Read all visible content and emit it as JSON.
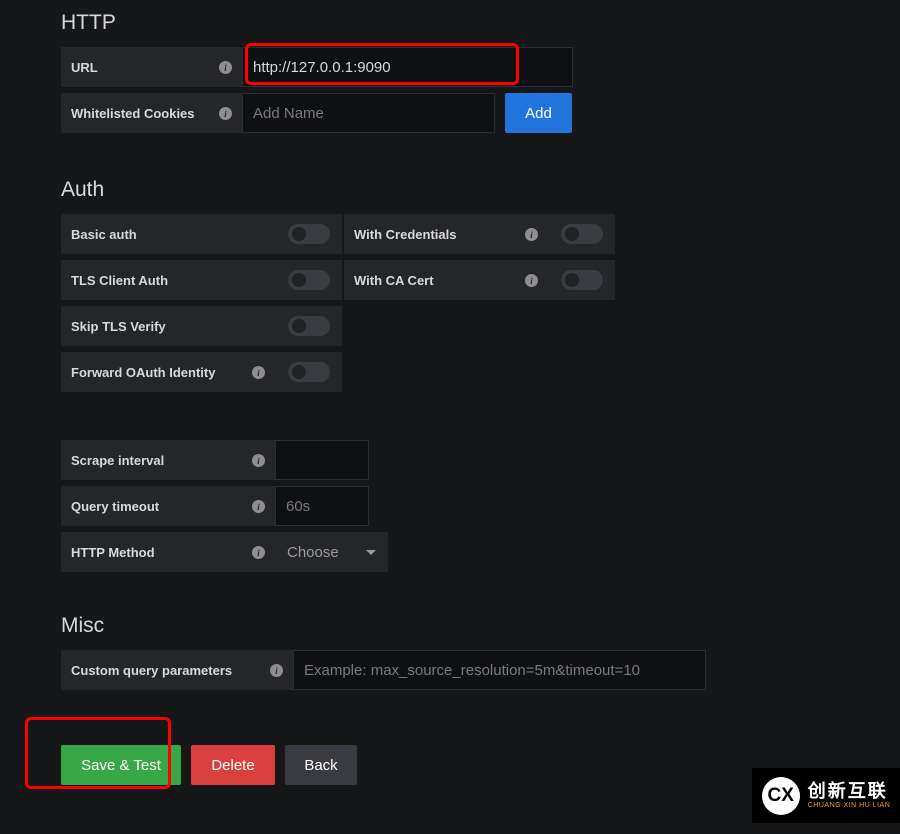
{
  "http": {
    "title": "HTTP",
    "url_label": "URL",
    "url_value": "http://127.0.0.1:9090",
    "cookies_label": "Whitelisted Cookies",
    "cookies_placeholder": "Add Name",
    "add_label": "Add"
  },
  "auth": {
    "title": "Auth",
    "basic_auth_label": "Basic auth",
    "with_credentials_label": "With Credentials",
    "tls_client_auth_label": "TLS Client Auth",
    "with_ca_cert_label": "With CA Cert",
    "skip_tls_verify_label": "Skip TLS Verify",
    "forward_oauth_label": "Forward OAuth Identity"
  },
  "extra": {
    "scrape_interval_label": "Scrape interval",
    "query_timeout_label": "Query timeout",
    "query_timeout_placeholder": "60s",
    "http_method_label": "HTTP Method",
    "http_method_value": "Choose"
  },
  "misc": {
    "title": "Misc",
    "custom_params_label": "Custom query parameters",
    "custom_params_placeholder": "Example: max_source_resolution=5m&timeout=10"
  },
  "actions": {
    "save_test_label": "Save & Test",
    "delete_label": "Delete",
    "back_label": "Back"
  },
  "watermark": {
    "logo": "CX",
    "line1": "创新互联",
    "line2": "CHUANG XIN HU LIAN"
  }
}
